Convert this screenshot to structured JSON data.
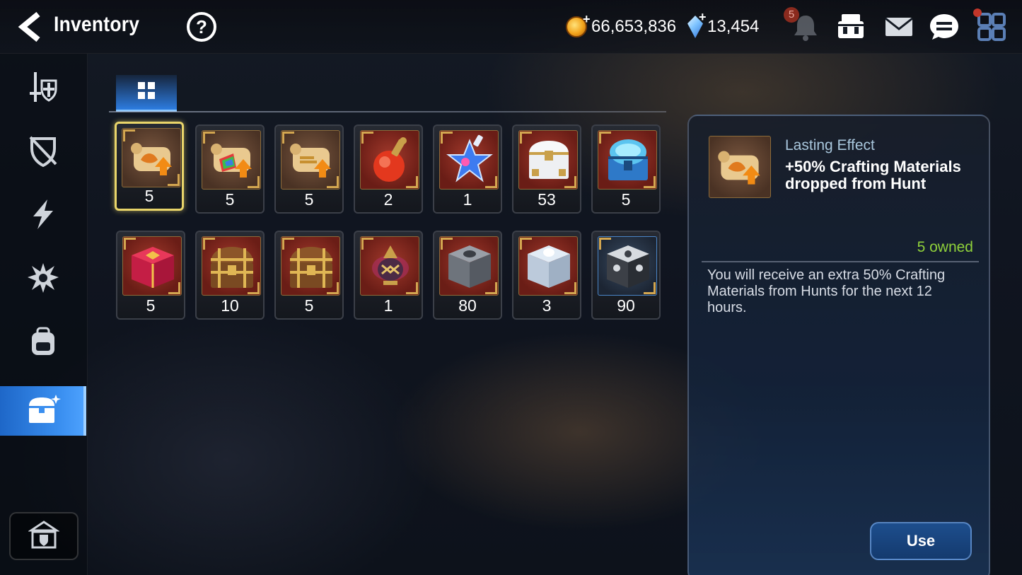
{
  "header": {
    "title": "Inventory",
    "help_label": "?",
    "gold_amount": "66,653,836",
    "gold_plus": "+",
    "gem_amount": "13,454",
    "gem_plus": "+",
    "notification_count": "5",
    "icons": [
      "back-arrow-icon",
      "help-icon",
      "gold-coin-icon",
      "crystal-icon",
      "bell-icon",
      "shop-icon",
      "mail-icon",
      "chat-icon",
      "menu-grid-icon"
    ]
  },
  "sidebar": {
    "items": [
      {
        "name": "equipment",
        "icon": "sword-shield-icon"
      },
      {
        "name": "unequipped",
        "icon": "crossed-shield-icon"
      },
      {
        "name": "energy",
        "icon": "lightning-icon"
      },
      {
        "name": "artifacts",
        "icon": "spiked-burst-icon"
      },
      {
        "name": "materials",
        "icon": "backpack-icon"
      },
      {
        "name": "consumables",
        "icon": "treasure-chest-icon",
        "active": true
      }
    ],
    "bottom_icon": "guild-hall-icon"
  },
  "tabs": [
    {
      "icon": "grid-icon",
      "active": true
    }
  ],
  "items": [
    {
      "icon": "scroll-orange-icon",
      "count": "5",
      "selected": true
    },
    {
      "icon": "scroll-rainbow-icon",
      "count": "5"
    },
    {
      "icon": "scroll-gold-icon",
      "count": "5"
    },
    {
      "icon": "red-potion-icon",
      "count": "2"
    },
    {
      "icon": "star-potion-icon",
      "count": "1"
    },
    {
      "icon": "white-chest-icon",
      "count": "53"
    },
    {
      "icon": "blue-chest-icon",
      "count": "5"
    },
    {
      "icon": "red-box-icon",
      "count": "5"
    },
    {
      "icon": "wooden-chest-icon",
      "count": "10"
    },
    {
      "icon": "wooden-chest-icon",
      "count": "5"
    },
    {
      "icon": "lamp-icon",
      "count": "1"
    },
    {
      "icon": "grey-box-icon",
      "count": "80"
    },
    {
      "icon": "silver-box-icon",
      "count": "3"
    },
    {
      "icon": "dark-box-icon",
      "count": "90"
    }
  ],
  "detail": {
    "category": "Lasting Effect",
    "name": "+50% Crafting Materials dropped from Hunt",
    "owned": "5 owned",
    "description": "You will receive an extra 50% Crafting Materials from Hunts for the next 12 hours.",
    "use_label": "Use",
    "icon": "scroll-orange-icon"
  },
  "colors": {
    "accent_blue": "#2d7ce0",
    "selected_border": "#e9d56a",
    "owned_green": "#8fd13a",
    "category_text": "#a9c7dd"
  }
}
